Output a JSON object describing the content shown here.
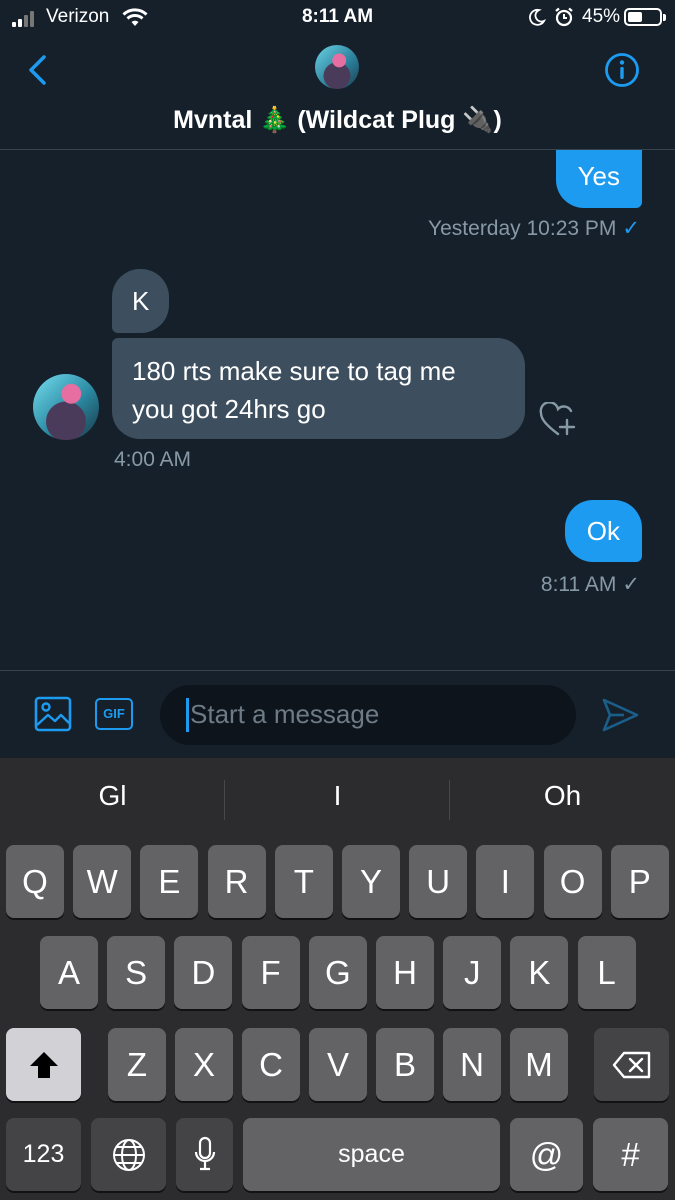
{
  "status_bar": {
    "carrier": "Verizon",
    "time": "8:11 AM",
    "battery_percent": "45%",
    "battery_level": 0.45,
    "icons": [
      "signal-icon",
      "wifi-icon",
      "moon-icon",
      "alarm-icon",
      "battery-icon"
    ]
  },
  "header": {
    "title": "Mvntal 🎄 (Wildcat Plug 🔌)",
    "icons": [
      "back-chevron-icon",
      "avatar",
      "info-icon"
    ]
  },
  "messages": [
    {
      "direction": "outgoing",
      "text": "Yes",
      "meta": "Yesterday 10:23 PM",
      "status": "✓",
      "status_color": "#1d9bf0"
    },
    {
      "direction": "incoming",
      "text": "K"
    },
    {
      "direction": "incoming",
      "lines": [
        "180 rts make sure to tag me",
        "you got 24hrs go"
      ],
      "meta": "4:00 AM"
    },
    {
      "direction": "outgoing",
      "text": "Ok",
      "meta": "8:11 AM",
      "status": "✓",
      "status_color": "#8899a6"
    }
  ],
  "composer": {
    "gif_label": "GIF",
    "placeholder": "Start a message",
    "icons": [
      "image-icon",
      "gif-icon",
      "send-icon"
    ]
  },
  "keyboard": {
    "suggestions": [
      "Gl",
      "I",
      "Oh"
    ],
    "row1": [
      "Q",
      "W",
      "E",
      "R",
      "T",
      "Y",
      "U",
      "I",
      "O",
      "P"
    ],
    "row2": [
      "A",
      "S",
      "D",
      "F",
      "G",
      "H",
      "J",
      "K",
      "L"
    ],
    "row3": [
      "Z",
      "X",
      "C",
      "V",
      "B",
      "N",
      "M"
    ],
    "numbers_key": "123",
    "space_key": "space",
    "at_key": "@",
    "hash_key": "#",
    "icons": [
      "shift-icon",
      "backspace-icon",
      "globe-icon",
      "microphone-icon"
    ]
  },
  "colors": {
    "background": "#15202b",
    "accent": "#1d9bf0",
    "incoming_bubble": "#3d4f5e",
    "muted_text": "#8899a6"
  }
}
